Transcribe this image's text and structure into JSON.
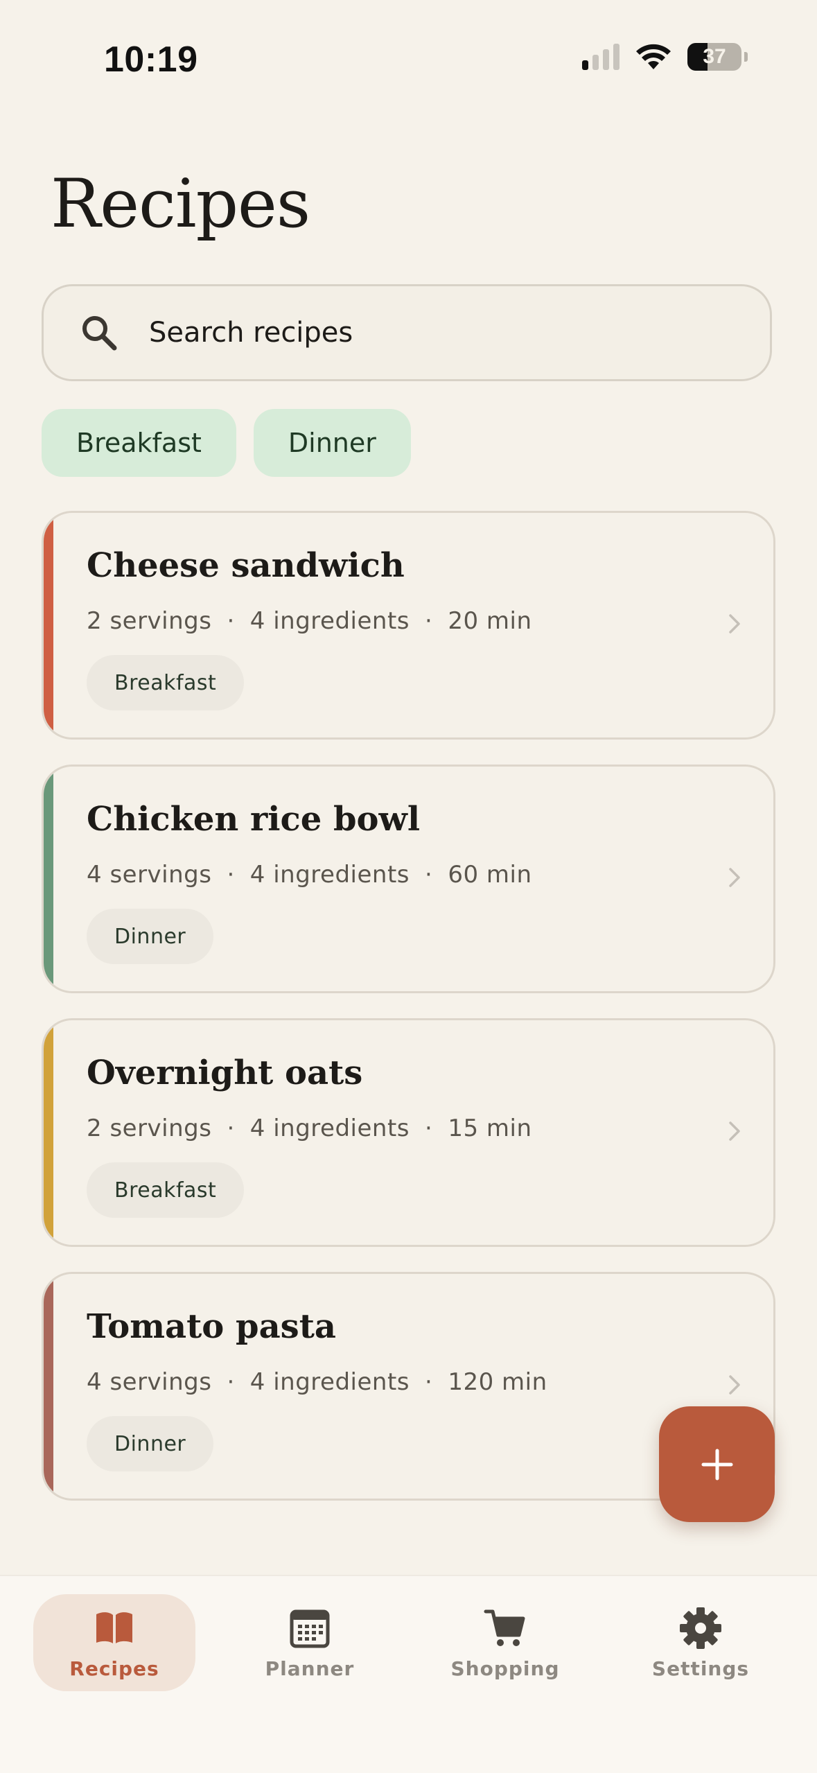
{
  "status_bar": {
    "time": "10:19",
    "battery_percent": "37",
    "battery_level": 0.37,
    "signal_bars_active": 1,
    "signal_bars_total": 4
  },
  "header": {
    "title": "Recipes"
  },
  "search": {
    "placeholder": "Search recipes",
    "icon": "search-icon"
  },
  "filters": [
    {
      "label": "Breakfast"
    },
    {
      "label": "Dinner"
    }
  ],
  "recipes": [
    {
      "title": "Cheese sandwich",
      "servings": "2 servings",
      "ingredients": "4 ingredients",
      "time": "20 min",
      "tag": "Breakfast",
      "accent": "#cf5f43"
    },
    {
      "title": "Chicken rice bowl",
      "servings": "4 servings",
      "ingredients": "4 ingredients",
      "time": "60 min",
      "tag": "Dinner",
      "accent": "#6a987a"
    },
    {
      "title": "Overnight oats",
      "servings": "2 servings",
      "ingredients": "4 ingredients",
      "time": "15 min",
      "tag": "Breakfast",
      "accent": "#d1a23a"
    },
    {
      "title": "Tomato pasta",
      "servings": "4 servings",
      "ingredients": "4 ingredients",
      "time": "120 min",
      "tag": "Dinner",
      "accent": "#a9675a"
    }
  ],
  "meta_separator": "·",
  "fab": {
    "icon": "plus-icon",
    "color": "#b95a3c"
  },
  "bottom_nav": [
    {
      "label": "Recipes",
      "icon": "book-icon",
      "active": true
    },
    {
      "label": "Planner",
      "icon": "calendar-icon",
      "active": false
    },
    {
      "label": "Shopping",
      "icon": "cart-icon",
      "active": false
    },
    {
      "label": "Settings",
      "icon": "gear-icon",
      "active": false
    }
  ],
  "colors": {
    "background": "#f6f2ea",
    "accent": "#b95a3c",
    "chip_bg": "#d7ecd9",
    "chip_text": "#1f3a25"
  }
}
